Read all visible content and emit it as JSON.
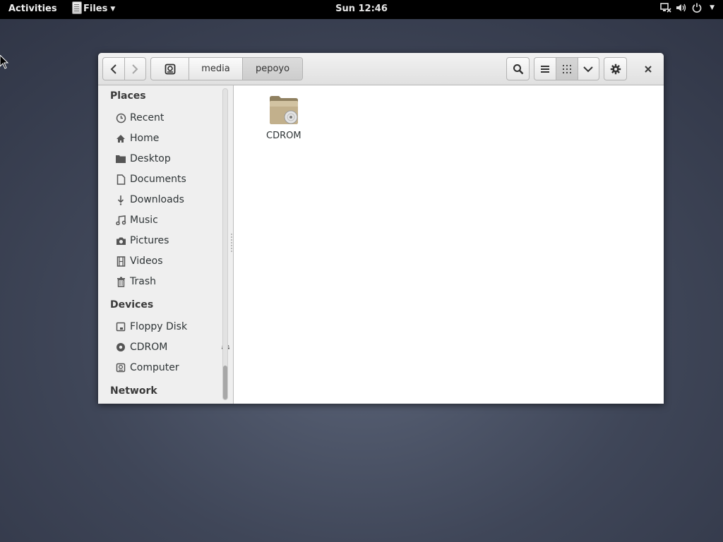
{
  "topbar": {
    "activities": "Activities",
    "app_menu": "Files",
    "clock": "Sun 12:46"
  },
  "window": {
    "path": {
      "root_icon": "drive-icon",
      "segments": [
        "media",
        "pepoyo"
      ]
    },
    "toolbar": {
      "back_icon": "chevron-left-icon",
      "forward_icon": "chevron-right-icon",
      "search_icon": "search-icon",
      "view_list_icon": "list-view-icon",
      "view_grid_icon": "grid-view-icon",
      "view_menu_icon": "chevron-down-icon",
      "settings_icon": "gear-icon",
      "close_icon": "close-icon"
    },
    "sidebar": {
      "places_title": "Places",
      "places": [
        {
          "label": "Recent",
          "icon": "clock-icon"
        },
        {
          "label": "Home",
          "icon": "home-icon"
        },
        {
          "label": "Desktop",
          "icon": "folder-icon"
        },
        {
          "label": "Documents",
          "icon": "document-icon"
        },
        {
          "label": "Downloads",
          "icon": "download-icon"
        },
        {
          "label": "Music",
          "icon": "music-icon"
        },
        {
          "label": "Pictures",
          "icon": "camera-icon"
        },
        {
          "label": "Videos",
          "icon": "film-icon"
        },
        {
          "label": "Trash",
          "icon": "trash-icon"
        }
      ],
      "devices_title": "Devices",
      "devices": [
        {
          "label": "Floppy Disk",
          "icon": "floppy-icon"
        },
        {
          "label": "CDROM",
          "icon": "disc-icon"
        },
        {
          "label": "Computer",
          "icon": "drive-icon"
        }
      ],
      "network_title": "Network"
    },
    "files": [
      {
        "name": "CDROM",
        "icon": "cdrom-folder-icon"
      }
    ]
  }
}
